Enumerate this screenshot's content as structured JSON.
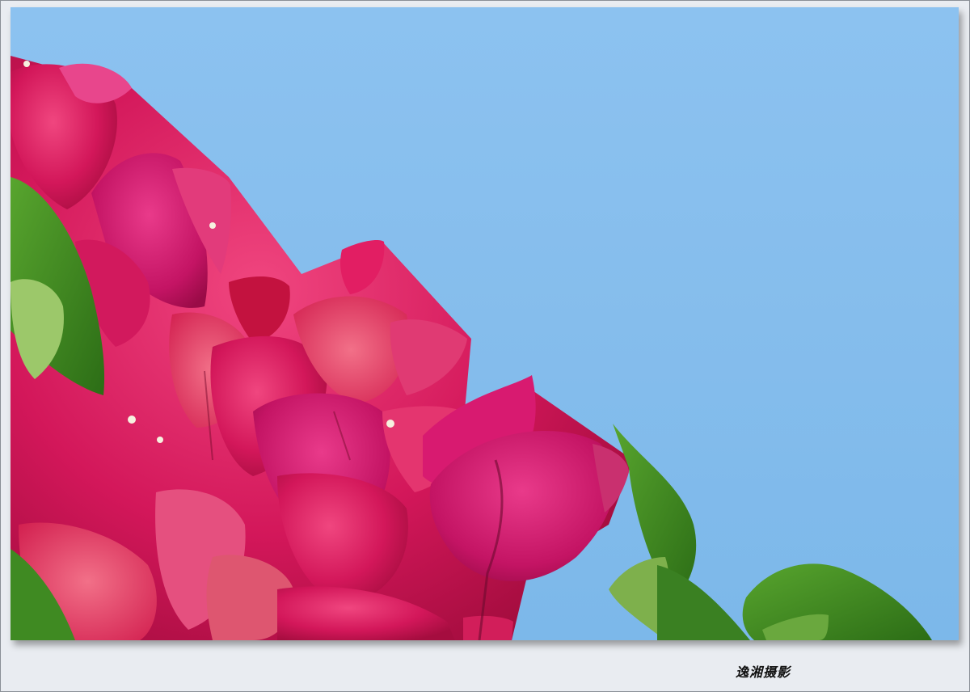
{
  "photo": {
    "subject": "bougainvillea-flowers-against-sky",
    "colors": {
      "sky": "#86bdec",
      "petal_magenta": "#d0185e",
      "petal_pink": "#e8347a",
      "leaf_green": "#3f8a22"
    }
  },
  "watermark": {
    "text": "逸湘摄影"
  }
}
